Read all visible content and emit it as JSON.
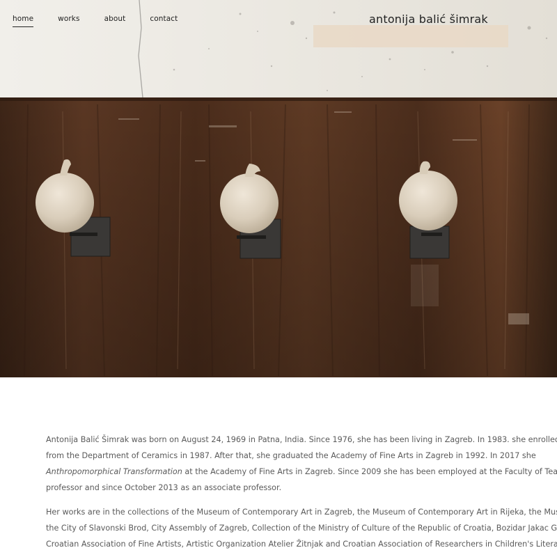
{
  "nav": {
    "items": [
      {
        "label": "home",
        "active": true
      },
      {
        "label": "works",
        "active": false
      },
      {
        "label": "about",
        "active": false
      },
      {
        "label": "contact",
        "active": false
      }
    ]
  },
  "brand": "antonija balić šimrak",
  "bio": {
    "p1": {
      "line1": "Antonija Balić Šimrak was born on August 24, 1969 in Patna, India. Since 1976, she has been living in Zagreb. In 1983. she enrolled in the School",
      "line2": "from the Department of Ceramics in 1987. After that, she graduated the Academy of Fine Arts in Zagreb in 1992. In 2017 she",
      "line3_em": "Anthropomorphical Transformation",
      "line3_rest": " at the Academy of Fine Arts in Zagreb. Since 2009 she has been employed at the Faculty of Teach",
      "line4": "professor and since October 2013 as an associate professor."
    },
    "p2": {
      "line1": "Her works are in the collections of the Museum of Contemporary Art in Zagreb, the Museum of Contemporary Art in Rijeka, the Museum",
      "line2": "the City of Slavonski Brod, City Assembly of Zagreb, Collection of the Ministry of Culture of the Republic of Croatia, Bozidar Jakac Gall",
      "line3": "Croatian Association of Fine Artists, Artistic Organization Atelier Žitnjak and Croatian Association of Researchers in Children's Literature"
    }
  },
  "hero": {
    "wall_color": "#e9e6df",
    "wood_color": "#4a2e1e",
    "ball_color": "#d8cdbd",
    "bracket_color": "#3a3a38"
  }
}
